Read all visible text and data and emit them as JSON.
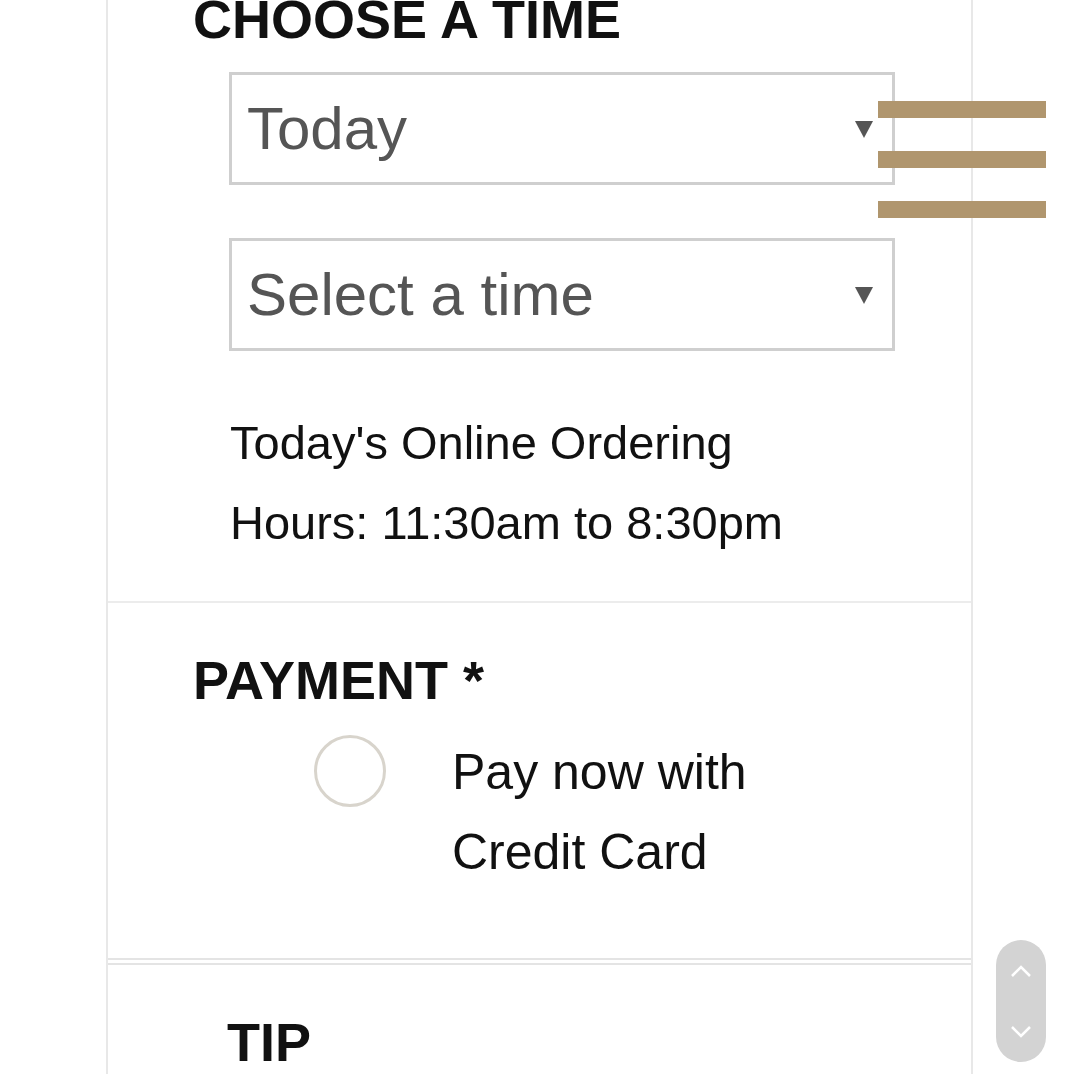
{
  "time_section": {
    "title": "CHOOSE A TIME",
    "selects": [
      {
        "value": "Today"
      },
      {
        "value": "Select a time"
      }
    ],
    "hours_note": "Today's Online Ordering Hours: 11:30am to 8:30pm"
  },
  "payment_section": {
    "title": "PAYMENT *",
    "options": [
      {
        "label": "Pay now with Credit Card",
        "selected": false
      }
    ]
  },
  "tip_section": {
    "title": "TIP"
  }
}
